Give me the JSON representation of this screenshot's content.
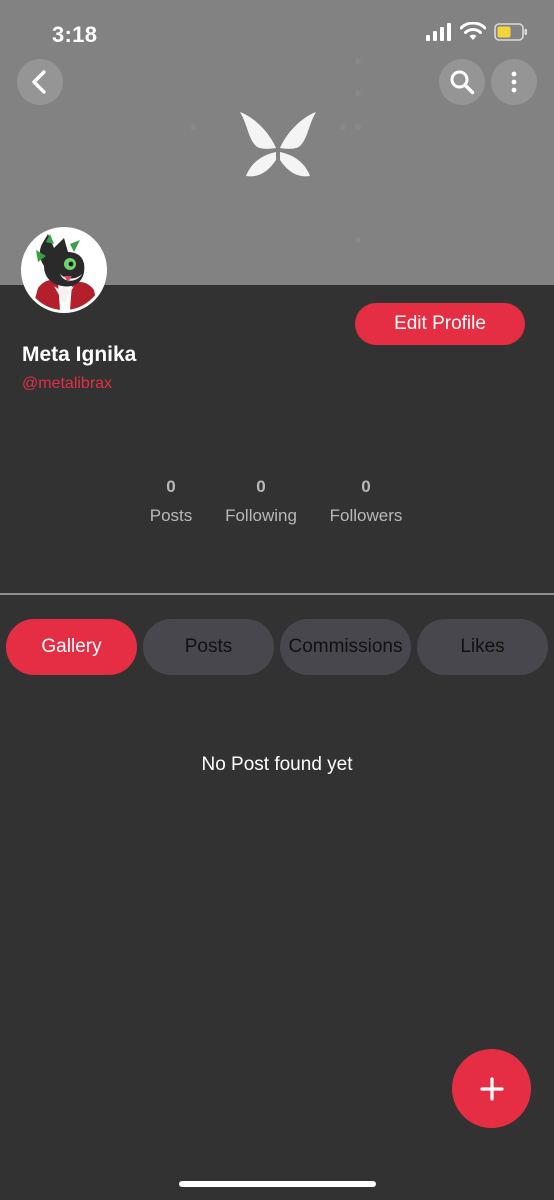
{
  "status_bar": {
    "time": "3:18",
    "icons": [
      "signal-icon",
      "wifi-icon",
      "battery-icon"
    ]
  },
  "header": {
    "back_icon": "chevron-left-icon",
    "search_icon": "search-icon",
    "more_icon": "more-vertical-icon",
    "banner_logo": "butterfly-logo"
  },
  "profile": {
    "name": "Meta Ignika",
    "handle": "@metalibrax",
    "edit_label": "Edit Profile"
  },
  "stats": [
    {
      "value": "0",
      "label": "Posts"
    },
    {
      "value": "0",
      "label": "Following"
    },
    {
      "value": "0",
      "label": "Followers"
    }
  ],
  "tabs": [
    {
      "label": "Gallery",
      "active": true
    },
    {
      "label": "Posts",
      "active": false
    },
    {
      "label": "Commissions",
      "active": false
    },
    {
      "label": "Likes",
      "active": false
    }
  ],
  "content": {
    "empty_message": "No Post found yet"
  },
  "fab": {
    "icon": "plus-icon"
  },
  "colors": {
    "accent": "#e52e44",
    "background": "#323232",
    "banner": "#828282",
    "tab_inactive": "#48474d"
  }
}
